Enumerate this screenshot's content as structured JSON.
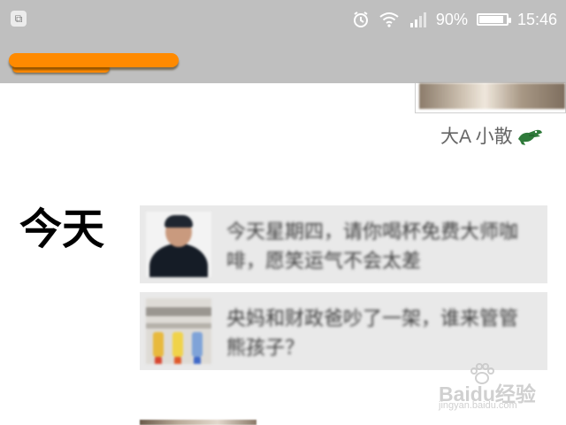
{
  "status_bar": {
    "left_icon": "screenshot-notification-icon",
    "icons": [
      "alarm-icon",
      "wifi-icon",
      "signal-icon"
    ],
    "battery_text": "90%",
    "battery_level": 0.9,
    "time": "15:46"
  },
  "app_bar": {
    "title_redacted": true,
    "redaction_color": "#ff8a00"
  },
  "top_article": {
    "author": "大A 小散",
    "author_icon": "crocodile-icon"
  },
  "section": {
    "title": "今天"
  },
  "feed": [
    {
      "thumb": "person-avatar-thumbnail",
      "title": "今天星期四，请你喝杯免费大师咖啡，愿笑运气不会太差"
    },
    {
      "thumb": "shelf-bottles-thumbnail",
      "title": "央妈和财政爸吵了一架，谁来管管熊孩子？"
    }
  ],
  "watermark": {
    "brand": "Baidu经验",
    "url": "jingyan.baidu.com"
  },
  "colors": {
    "bar_gray": "#bfbfbf",
    "card_gray": "#e9e9e9",
    "text_dark": "#3a3a3a"
  }
}
